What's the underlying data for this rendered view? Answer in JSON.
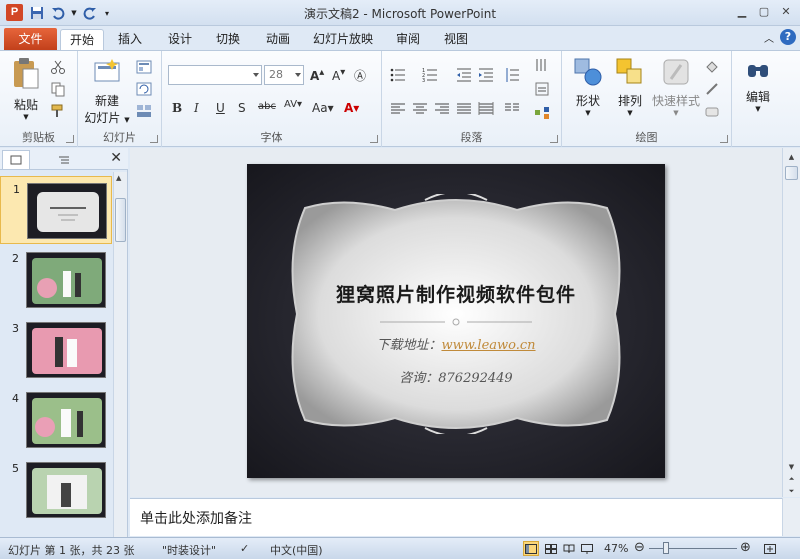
{
  "window": {
    "title": "演示文稿2 - Microsoft PowerPoint",
    "app_icon": "P"
  },
  "qat": {
    "icons": [
      "save-icon",
      "undo-icon",
      "redo-icon",
      "customize-icon"
    ]
  },
  "tabs": {
    "file": "文件",
    "items": [
      "开始",
      "插入",
      "设计",
      "切换",
      "动画",
      "幻灯片放映",
      "审阅",
      "视图"
    ],
    "active": "开始"
  },
  "ribbon": {
    "clipboard": {
      "label": "剪贴板",
      "paste": "粘贴"
    },
    "slides": {
      "label": "幻灯片",
      "new_slide_1": "新建",
      "new_slide_2": "幻灯片"
    },
    "font": {
      "label": "字体",
      "size_value": "28"
    },
    "paragraph": {
      "label": "段落"
    },
    "drawing": {
      "label": "绘图",
      "shapes": "形状",
      "arrange": "排列",
      "quick_styles": "快速样式"
    },
    "editing": {
      "label": "编辑",
      "edit": "编辑"
    }
  },
  "slides_panel": {
    "numbers": [
      "1",
      "2",
      "3",
      "4",
      "5"
    ],
    "selected": "1"
  },
  "slide": {
    "title": "狸窝照片制作视频软件包件",
    "download_label": "下载地址：",
    "download_url": "www.leawo.cn",
    "contact": "咨询：876292449"
  },
  "notes": {
    "placeholder": "单击此处添加备注"
  },
  "status": {
    "slide_info": "幻灯片 第 1 张，共 23 张",
    "theme": "\"时装设计\"",
    "language": "中文(中国)",
    "zoom": "47%"
  },
  "colors": {
    "file_tab": "#d24726",
    "accent": "#fbd77b",
    "link": "#c08a3a"
  }
}
